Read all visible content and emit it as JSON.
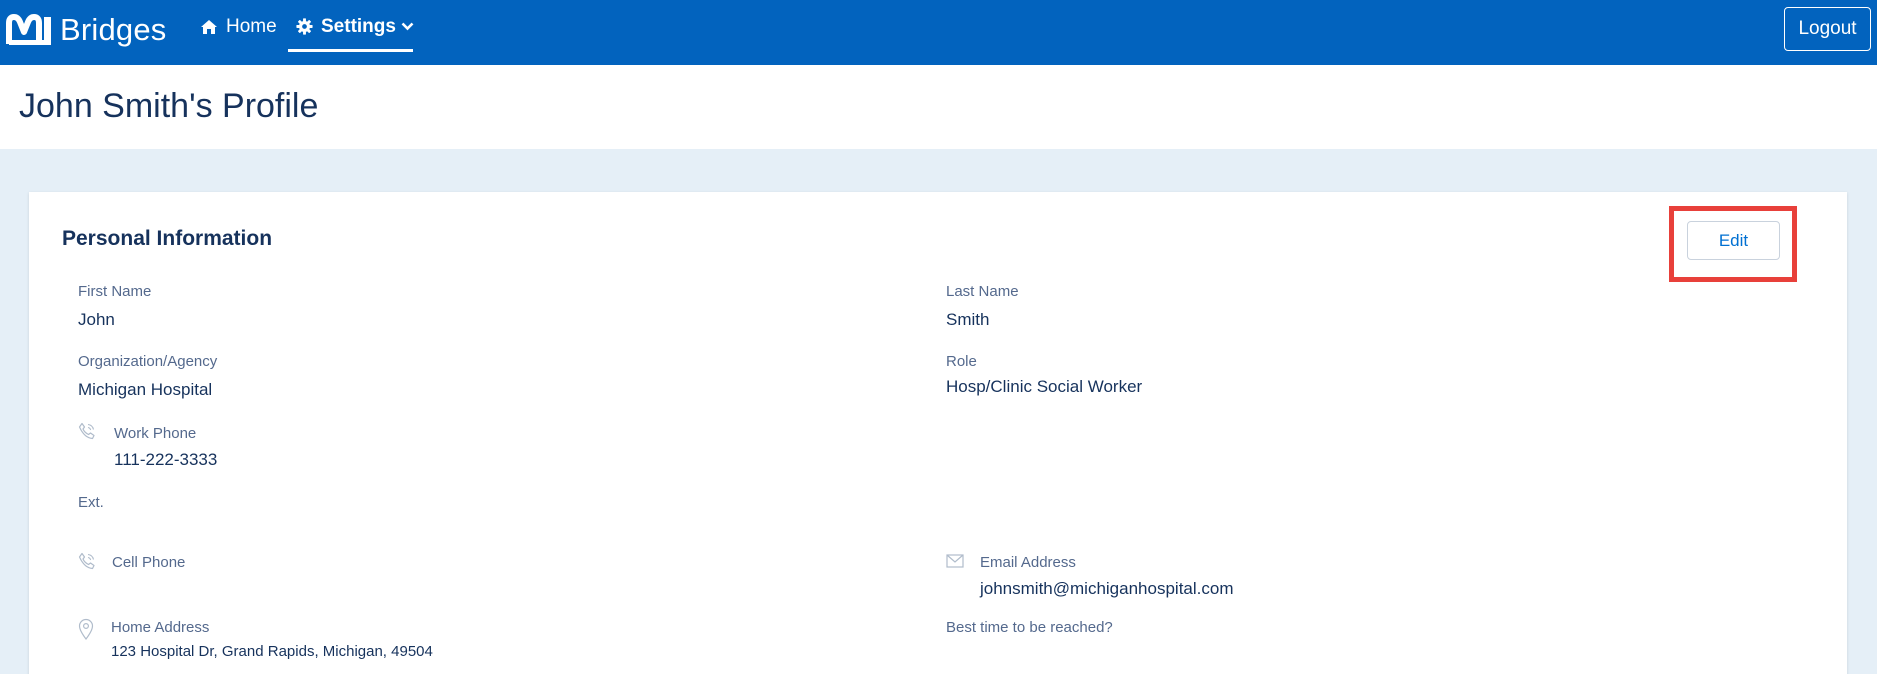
{
  "topbar": {
    "logo_text": "Bridges",
    "nav_home": "Home",
    "nav_settings": "Settings",
    "logout": "Logout",
    "background": "#0263be"
  },
  "page": {
    "title": "John Smith's Profile"
  },
  "personal_info": {
    "section_title": "Personal Information",
    "edit_label": "Edit",
    "first_name": {
      "label": "First Name",
      "value": "John"
    },
    "last_name": {
      "label": "Last Name",
      "value": "Smith"
    },
    "organization": {
      "label": "Organization/Agency",
      "value": "Michigan Hospital"
    },
    "role": {
      "label": "Role",
      "value": "Hosp/Clinic Social Worker"
    },
    "work_phone": {
      "label": "Work Phone",
      "value": "111-222-3333"
    },
    "ext": {
      "label": "Ext.",
      "value": ""
    },
    "cell_phone": {
      "label": "Cell Phone",
      "value": ""
    },
    "email": {
      "label": "Email Address",
      "value": "johnsmith@michiganhospital.com"
    },
    "home_address": {
      "label": "Home Address",
      "value": "123 Hospital Dr, Grand Rapids, Michigan, 49504"
    },
    "best_time": {
      "label": "Best time to be reached?",
      "value": ""
    }
  },
  "icons": {
    "home": "home-icon",
    "settings": "gear-icon",
    "chevron": "chevron-down-icon",
    "phone": "phone-icon",
    "email": "envelope-icon",
    "location": "location-pin-icon"
  },
  "colors": {
    "accent": "#0070d2",
    "highlight": "#e8403a",
    "text": "#16325c",
    "label": "#54698d"
  }
}
